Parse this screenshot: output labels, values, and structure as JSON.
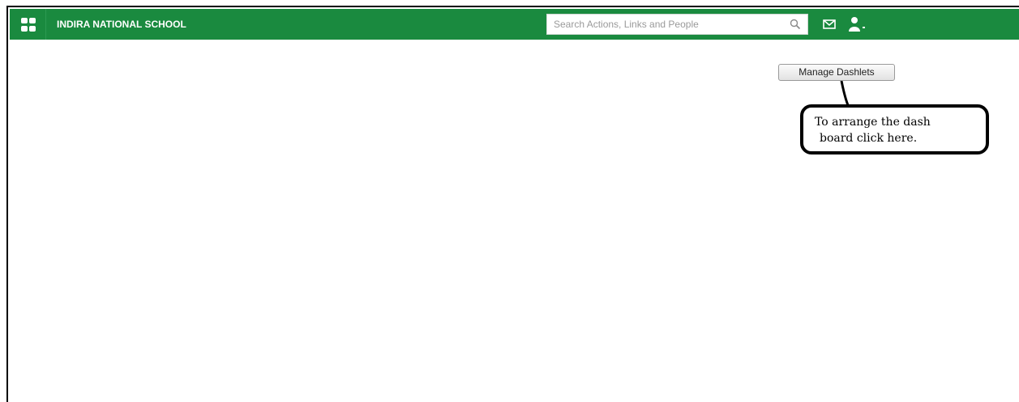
{
  "header": {
    "apps_icon": "apps-grid-icon",
    "school_name": "INDIRA NATIONAL SCHOOL",
    "search": {
      "placeholder": "Search Actions, Links and People",
      "value": ""
    },
    "search_icon": "search-icon",
    "mail_icon": "envelope-icon",
    "user_icon": "user-icon",
    "brand_color": "#1a8a3f"
  },
  "main": {
    "manage_button_label": "Manage Dashlets"
  },
  "callout": {
    "line1": "To arrange the dash",
    "line2": "board click here."
  }
}
